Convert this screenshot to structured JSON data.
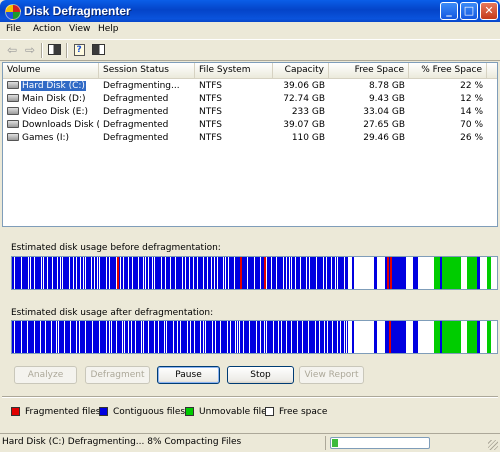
{
  "window": {
    "title": "Disk Defragmenter"
  },
  "titlebar_buttons": {
    "minimize": "_",
    "maximize": "□",
    "close": "✕"
  },
  "menu": [
    {
      "label": "File"
    },
    {
      "label": "Action"
    },
    {
      "label": "View"
    },
    {
      "label": "Help"
    }
  ],
  "toolbar": {
    "back_icon": "back-arrow-icon",
    "forward_icon": "forward-arrow-icon",
    "back": "⇦",
    "forward": "⇨"
  },
  "volumes": {
    "columns": [
      "Volume",
      "Session Status",
      "File System",
      "Capacity",
      "Free Space",
      "% Free Space"
    ],
    "rows": [
      {
        "name": "Hard Disk (C:)",
        "status": "Defragmenting...",
        "fs": "NTFS",
        "capacity": "39.06 GB",
        "free": "8.78 GB",
        "pct": "22 %",
        "selected": true
      },
      {
        "name": "Main Disk (D:)",
        "status": "Defragmented",
        "fs": "NTFS",
        "capacity": "72.74 GB",
        "free": "9.43 GB",
        "pct": "12 %"
      },
      {
        "name": "Video Disk (E:)",
        "status": "Defragmented",
        "fs": "NTFS",
        "capacity": "233 GB",
        "free": "33.04 GB",
        "pct": "14 %"
      },
      {
        "name": "Downloads Disk (F:)",
        "status": "Defragmented",
        "fs": "NTFS",
        "capacity": "39.07 GB",
        "free": "27.65 GB",
        "pct": "70 %"
      },
      {
        "name": "Games (I:)",
        "status": "Defragmented",
        "fs": "NTFS",
        "capacity": "110 GB",
        "free": "29.46 GB",
        "pct": "26 %"
      }
    ]
  },
  "analysis": {
    "before_label": "Estimated disk usage before defragmentation:",
    "after_label": "Estimated disk usage after defragmentation:"
  },
  "buttons": {
    "analyze": "Analyze",
    "defragment": "Defragment",
    "pause": "Pause",
    "stop": "Stop",
    "view_report": "View Report"
  },
  "legend": [
    {
      "label": "Fragmented files",
      "color": "#e00000"
    },
    {
      "label": "Contiguous files",
      "color": "#0000e0"
    },
    {
      "label": "Unmovable files",
      "color": "#00cc00"
    },
    {
      "label": "Free space",
      "color": "#ffffff"
    }
  ],
  "status": {
    "text": "Hard Disk (C:) Defragmenting...  8%  Compacting Files",
    "progress_percent": 8
  },
  "colors": {
    "fragmented": "#e00000",
    "contiguous": "#0000e0",
    "unmovable": "#00cc00",
    "free": "#ffffff"
  }
}
